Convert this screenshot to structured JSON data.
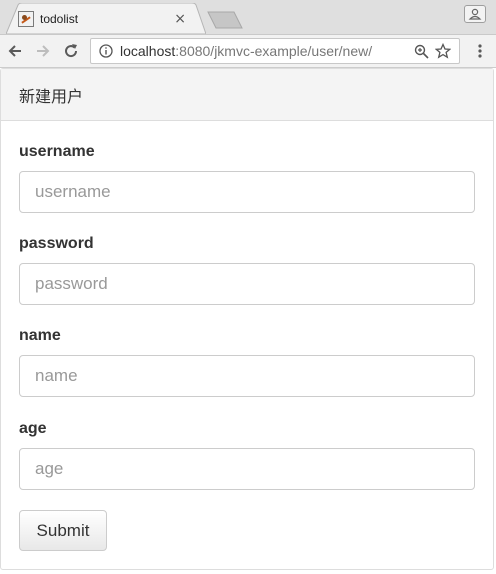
{
  "browser": {
    "tab_title": "todolist",
    "tab_close": "×",
    "url_host": "localhost",
    "url_rest": ":8080/jkmvc-example/user/new/"
  },
  "page": {
    "heading": "新建用户",
    "fields": [
      {
        "label": "username",
        "placeholder": "username"
      },
      {
        "label": "password",
        "placeholder": "password"
      },
      {
        "label": "name",
        "placeholder": "name"
      },
      {
        "label": "age",
        "placeholder": "age"
      }
    ],
    "submit_label": "Submit"
  }
}
